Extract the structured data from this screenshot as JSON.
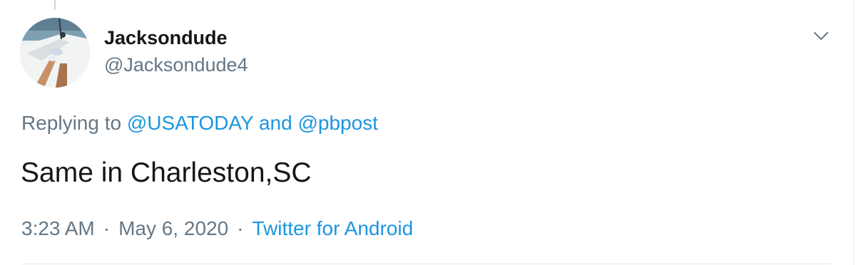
{
  "user": {
    "display_name": "Jacksondude",
    "handle": "@Jacksondude4",
    "avatar_icon": "avatar-photo-icon"
  },
  "menu": {
    "icon": "chevron-down-icon"
  },
  "reply": {
    "prefix": "Replying to",
    "mention_1": "@USATODAY",
    "joiner": "and",
    "mention_2": "@pbpost"
  },
  "tweet": {
    "text": "Same in Charleston,SC"
  },
  "meta": {
    "time": "3:23 AM",
    "separator": "·",
    "date": "May 6, 2020",
    "source": "Twitter for Android"
  },
  "colors": {
    "link": "#1b95e0",
    "muted": "#657786",
    "text": "#14171a",
    "border": "#e6ecf0"
  }
}
